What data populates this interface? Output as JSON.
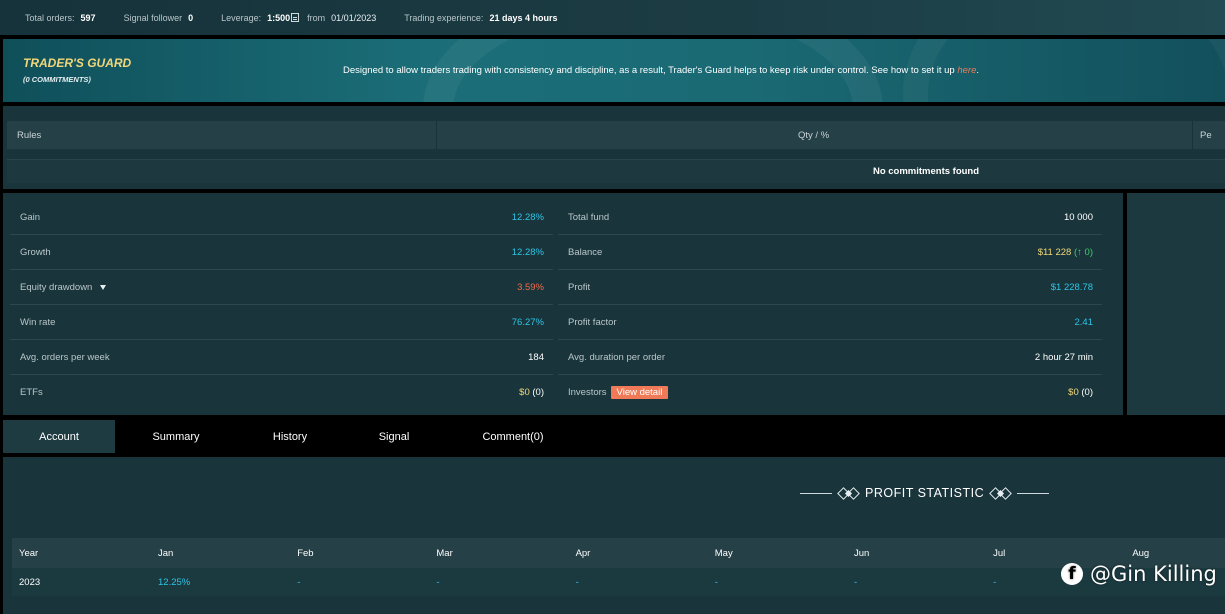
{
  "topbar": {
    "total_orders_label": "Total orders:",
    "total_orders_value": "597",
    "signal_follower_label": "Signal follower",
    "signal_follower_value": "0",
    "leverage_label": "Leverage:",
    "leverage_value": "1:500",
    "from_label": "from",
    "from_value": "01/01/2023",
    "trading_experience_label": "Trading experience:",
    "trading_experience_value": "21 days 4 hours"
  },
  "banner": {
    "title": "TRADER'S GUARD",
    "subtitle": "(0 COMMITMENTS)",
    "description": "Designed to allow traders trading with consistency and discipline, as a result, Trader's Guard helps to keep risk under control. See how to set it up",
    "link": "here",
    "period": "."
  },
  "rules": {
    "col_rules": "Rules",
    "col_qty": "Qty / %",
    "col_third": "Pe",
    "empty_message": "No commitments found"
  },
  "stats": {
    "left": [
      {
        "label": "Gain",
        "value": "12.28%"
      },
      {
        "label": "Growth",
        "value": "12.28%"
      },
      {
        "label": "Equity drawdown",
        "value": "3.59%"
      },
      {
        "label": "Win rate",
        "value": "76.27%"
      },
      {
        "label": "Avg. orders per week",
        "value": "184"
      },
      {
        "label": "ETFs",
        "value": "$0",
        "extra": "(0)"
      }
    ],
    "right": [
      {
        "label": "Total fund",
        "value": "10 000"
      },
      {
        "label": "Balance",
        "value": "$11 228",
        "extra_open": "(",
        "extra_arrow": "↑",
        "extra_num": "0",
        "extra_close": ")"
      },
      {
        "label": "Profit",
        "value": "$1 228.78"
      },
      {
        "label": "Profit factor",
        "value": "2.41"
      },
      {
        "label": "Avg. duration per order",
        "value": "2 hour 27 min"
      },
      {
        "label": "Investors",
        "button": "View detail",
        "value": "$0",
        "extra": "(0)"
      }
    ]
  },
  "tabs": [
    "Account",
    "Summary",
    "History",
    "Signal",
    "Comment(0)"
  ],
  "profit_statistic": {
    "title": "PROFIT STATISTIC",
    "headers": [
      "Year",
      "Jan",
      "Feb",
      "Mar",
      "Apr",
      "May",
      "Jun",
      "Jul",
      "Aug"
    ],
    "rows": [
      {
        "year": "2023",
        "values": [
          "12.25%",
          "-",
          "-",
          "-",
          "-",
          "-",
          "-",
          ""
        ]
      }
    ]
  },
  "watermark": {
    "icon": "facebook-icon",
    "text": "@Gin Killing"
  },
  "colors": {
    "accent_blue": "#2ec4e6",
    "negative": "#f06b4a",
    "money_yellow": "#f2d77a",
    "button": "#f07a57",
    "panel": "#19353b"
  }
}
